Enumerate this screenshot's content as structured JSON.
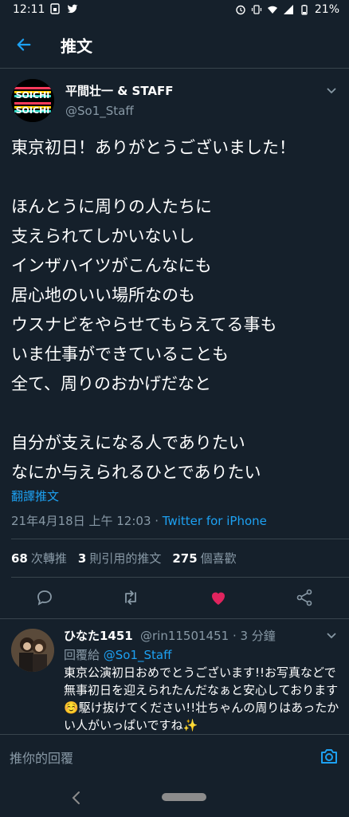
{
  "status_bar": {
    "time": "12:11",
    "battery": "21%"
  },
  "header": {
    "title": "推文"
  },
  "tweet": {
    "author_name": "平間壮一 & STAFF",
    "author_handle": "@So1_Staff",
    "avatar_text": "SOICHI",
    "text": "東京初日！ありがとうございました！\n\nほんとうに周りの人たちに\n支えられてしかいないし\nインザハイツがこんなにも\n居心地のいい場所なのも\nウスナビをやらせてもらえてる事も\nいま仕事ができていることも\n全て、周りのおかげだなと\n\n自分が支えになる人でありたい\nなにか与えられるひとでありたい",
    "translate_label": "翻譯推文",
    "timestamp": "21年4月18日 上午 12:03 · ",
    "source": "Twitter for iPhone",
    "stats": {
      "retweets_count": "68",
      "retweets_label": "次轉推",
      "quotes_count": "3",
      "quotes_label": "則引用的推文",
      "likes_count": "275",
      "likes_label": "個喜歡"
    }
  },
  "reply": {
    "name": "ひなた1451",
    "handle": "@rin11501451 · 3 分鐘",
    "reply_to_label": "回覆給 ",
    "reply_to_mention": "@So1_Staff",
    "text": "東京公演初日おめでとうございます!!お写真などで無事初日を迎えられたんだなぁと安心しております☺️駆け抜けてください!!壮ちゃんの周りはあったかい人がいっぱいですね✨"
  },
  "compose": {
    "placeholder": "推你的回覆"
  },
  "colors": {
    "background": "#15202b",
    "accent": "#1da1f2",
    "muted": "#8899a6",
    "like": "#e0245e",
    "divider": "#38444d"
  }
}
